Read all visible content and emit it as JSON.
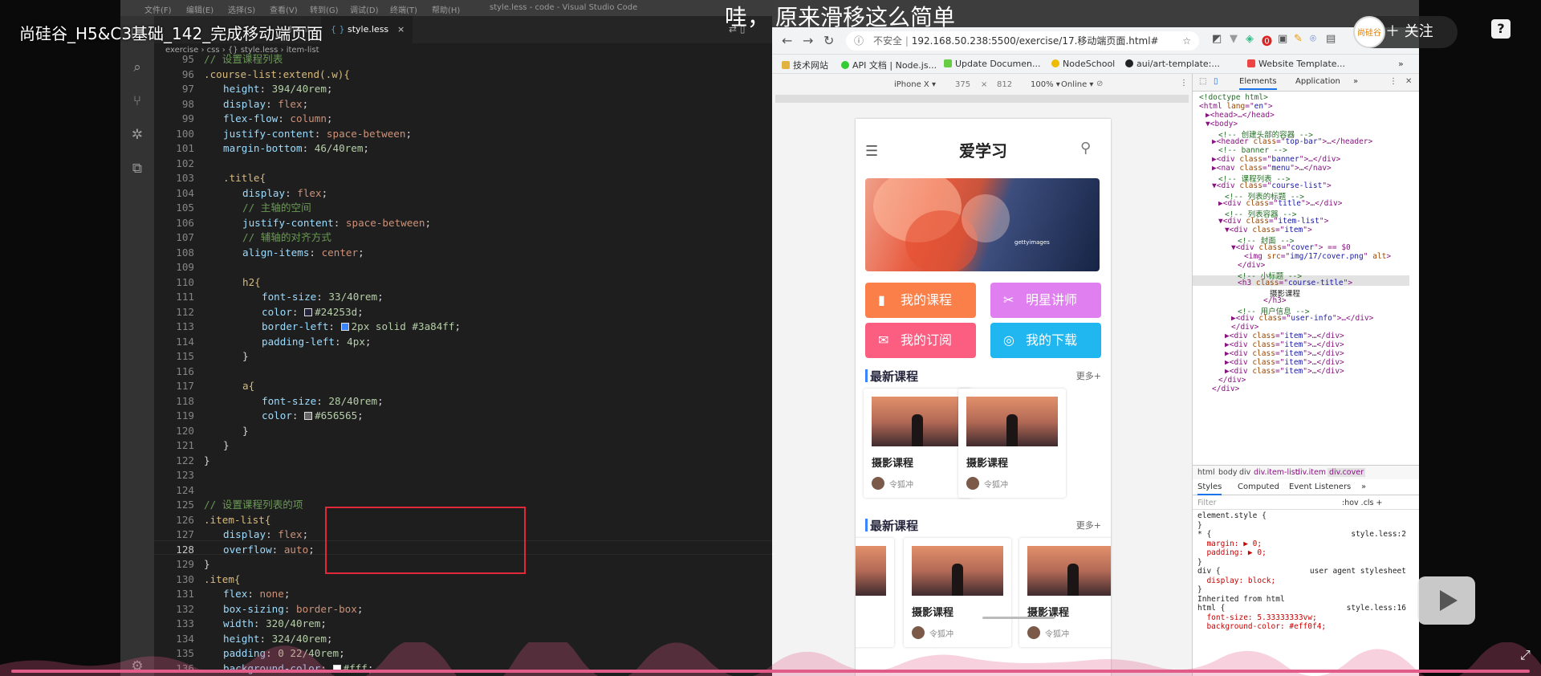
{
  "overlay": {
    "video_title": "尚硅谷_H5&C3基础_142_完成移动端页面",
    "hdr_wa": "哇，",
    "hdr_caption": "原来滑移这么简单",
    "follow": "关注",
    "logo_text": "尚硅谷",
    "help": "?"
  },
  "vscode": {
    "menu": [
      "文件(F)",
      "编辑(E)",
      "选择(S)",
      "查看(V)",
      "转到(G)",
      "调试(D)",
      "终端(T)",
      "帮助(H)"
    ],
    "window_title": "style.less - code - Visual Studio Code",
    "tabs": [
      {
        "label": "l.html"
      },
      {
        "label": "style.less"
      }
    ],
    "breadcrumb": [
      "exercise",
      "css",
      "{} style.less",
      "item-list"
    ],
    "code_lines": [
      {
        "n": "95",
        "t": "// 设置课程列表",
        "k": "cmt",
        "i": 0
      },
      {
        "n": "96",
        "t": ".course-list:extend(.w){",
        "k": "sel",
        "i": 0
      },
      {
        "n": "97",
        "p": "height",
        "v": "394/40rem",
        "i": 1
      },
      {
        "n": "98",
        "p": "display",
        "v": "flex",
        "i": 1
      },
      {
        "n": "99",
        "p": "flex-flow",
        "v": "column",
        "i": 1
      },
      {
        "n": "100",
        "p": "justify-content",
        "v": "space-between",
        "i": 1
      },
      {
        "n": "101",
        "p": "margin-bottom",
        "v": "46/40rem",
        "i": 1
      },
      {
        "n": "102",
        "t": "",
        "i": 0
      },
      {
        "n": "103",
        "t": ".title{",
        "k": "sel",
        "i": 1
      },
      {
        "n": "104",
        "p": "display",
        "v": "flex",
        "i": 2
      },
      {
        "n": "105",
        "t": "// 主轴的空间",
        "k": "cmt",
        "i": 2
      },
      {
        "n": "106",
        "p": "justify-content",
        "v": "space-between",
        "i": 2
      },
      {
        "n": "107",
        "t": "// 辅轴的对齐方式",
        "k": "cmt",
        "i": 2
      },
      {
        "n": "108",
        "p": "align-items",
        "v": "center",
        "i": 2
      },
      {
        "n": "109",
        "t": "",
        "i": 0
      },
      {
        "n": "110",
        "t": "h2{",
        "k": "sel",
        "i": 2
      },
      {
        "n": "111",
        "p": "font-size",
        "v": "33/40rem",
        "i": 3
      },
      {
        "n": "112",
        "p": "color",
        "v": "#24253d",
        "sw": "#24253d",
        "i": 3
      },
      {
        "n": "113",
        "p": "border-left",
        "v": "2px solid #3a84ff",
        "sw": "#3a84ff",
        "i": 3
      },
      {
        "n": "114",
        "p": "padding-left",
        "v": "4px",
        "i": 3
      },
      {
        "n": "115",
        "t": "}",
        "k": "pun",
        "i": 2
      },
      {
        "n": "116",
        "t": "",
        "i": 0
      },
      {
        "n": "117",
        "t": "a{",
        "k": "sel",
        "i": 2
      },
      {
        "n": "118",
        "p": "font-size",
        "v": "28/40rem",
        "i": 3
      },
      {
        "n": "119",
        "p": "color",
        "v": "#656565",
        "sw": "#656565",
        "i": 3
      },
      {
        "n": "120",
        "t": "}",
        "k": "pun",
        "i": 2
      },
      {
        "n": "121",
        "t": "}",
        "k": "pun",
        "i": 1
      },
      {
        "n": "122",
        "t": "}",
        "k": "pun",
        "i": 0
      },
      {
        "n": "123",
        "t": "",
        "i": 0
      },
      {
        "n": "124",
        "t": "",
        "i": 0
      },
      {
        "n": "125",
        "t": "// 设置课程列表的项",
        "k": "cmt",
        "i": 0
      },
      {
        "n": "126",
        "t": ".item-list{",
        "k": "sel",
        "i": 0
      },
      {
        "n": "127",
        "p": "display",
        "v": "flex",
        "i": 1
      },
      {
        "n": "128",
        "p": "overflow",
        "v": "auto",
        "i": 1
      },
      {
        "n": "129",
        "t": "}",
        "k": "pun",
        "i": 0
      },
      {
        "n": "130",
        "t": ".item{",
        "k": "sel",
        "i": 0
      },
      {
        "n": "131",
        "p": "flex",
        "v": "none",
        "i": 1
      },
      {
        "n": "132",
        "p": "box-sizing",
        "v": "border-box",
        "i": 1
      },
      {
        "n": "133",
        "p": "width",
        "v": "320/40rem",
        "i": 1
      },
      {
        "n": "134",
        "p": "height",
        "v": "324/40rem",
        "i": 1
      },
      {
        "n": "135",
        "p": "padding",
        "v": "0 22/40rem",
        "i": 1
      },
      {
        "n": "136",
        "p": "background-color",
        "v": "#fff",
        "sw": "#ffffff",
        "i": 1
      }
    ]
  },
  "browser": {
    "url_label": "不安全",
    "url": "192.168.50.238:5500/exercise/17.移动端页面.html#",
    "bookmarks": [
      "技术网站",
      "API 文档 | Node.js...",
      "Update Documen...",
      "NodeSchool",
      "aui/art-template:...",
      "Website Template..."
    ],
    "device": {
      "name": "iPhone X ▾",
      "width": "375",
      "x": "×",
      "height": "812",
      "zoom": "100% ▾",
      "net": "Online ▾"
    },
    "phone": {
      "title": "爱学习",
      "banner_mark": "gettyimages",
      "tiles": [
        {
          "label": "我的课程",
          "icon": "▮",
          "color": "#fa7f49"
        },
        {
          "label": "明星讲师",
          "icon": "✂",
          "color": "#e07ff0"
        },
        {
          "label": "我的订阅",
          "icon": "✉",
          "color": "#fb5e80"
        },
        {
          "label": "我的下载",
          "icon": "◎",
          "color": "#20b6f0"
        }
      ],
      "sections": [
        {
          "title": "最新课程",
          "more": "更多+",
          "cards": [
            {
              "title": "摄影课程",
              "author": "令狐冲"
            },
            {
              "title": "摄影课程",
              "author": "令狐冲"
            }
          ]
        },
        {
          "title": "最新课程",
          "more": "更多+",
          "cards": [
            {
              "title": "摄影课程",
              "author": "令狐冲"
            },
            {
              "title": "摄影课程",
              "author": "令狐冲"
            }
          ]
        }
      ]
    },
    "devtools": {
      "tabs": [
        "Elements",
        "Application",
        "»"
      ],
      "dom": [
        {
          "ind": 0,
          "html": "&lt;!doctype html&gt;",
          "cls": "cm"
        },
        {
          "ind": 0,
          "html": "&lt;html <span class='att'>lang</span>=\"<span class='av'>en</span>\"&gt;"
        },
        {
          "ind": 1,
          "html": "▶&lt;head&gt;…&lt;/head&gt;"
        },
        {
          "ind": 1,
          "html": "▼&lt;body&gt;"
        },
        {
          "ind": 3,
          "html": "&lt;!-- 创建头部的容器 --&gt;",
          "cls": "cm"
        },
        {
          "ind": 2,
          "html": "▶&lt;header <span class='att'>class</span>=\"<span class='av'>top-bar</span>\"&gt;…&lt;/header&gt;"
        },
        {
          "ind": 3,
          "html": "&lt;!-- banner --&gt;",
          "cls": "cm"
        },
        {
          "ind": 2,
          "html": "▶&lt;div <span class='att'>class</span>=\"<span class='av'>banner</span>\"&gt;…&lt;/div&gt;"
        },
        {
          "ind": 2,
          "html": "▶&lt;nav <span class='att'>class</span>=\"<span class='av'>menu</span>\"&gt;…&lt;/nav&gt;"
        },
        {
          "ind": 3,
          "html": "&lt;!-- 课程列表 --&gt;",
          "cls": "cm"
        },
        {
          "ind": 2,
          "html": "▼&lt;div <span class='att'>class</span>=\"<span class='av'>course-list</span>\"&gt;"
        },
        {
          "ind": 4,
          "html": "&lt;!-- 列表的标题 --&gt;",
          "cls": "cm"
        },
        {
          "ind": 3,
          "html": "▶&lt;div <span class='att'>class</span>=\"<span class='av'>title</span>\"&gt;…&lt;/div&gt;"
        },
        {
          "ind": 4,
          "html": "&lt;!-- 列表容器 --&gt;",
          "cls": "cm"
        },
        {
          "ind": 3,
          "html": "▼&lt;div <span class='att'>class</span>=\"<span class='av'>item-list</span>\"&gt;"
        },
        {
          "ind": 4,
          "html": "▼&lt;div <span class='att'>class</span>=\"<span class='av'>item</span>\"&gt;"
        },
        {
          "ind": 6,
          "html": "&lt;!-- 封面 --&gt;",
          "cls": "cm"
        },
        {
          "ind": 5,
          "html": "▼&lt;div <span class='att'>class</span>=\"<span class='av'>cover</span>\"&gt; == $0"
        },
        {
          "ind": 7,
          "html": "&lt;img <span class='att'>src</span>=\"<span class='av'>img/17/cover.png</span>\" <span class='att'>alt</span>&gt;"
        },
        {
          "ind": 6,
          "html": "&lt;/div&gt;"
        },
        {
          "ind": 6,
          "html": "&lt;!-- 小标题 --&gt;",
          "cls": "cm"
        },
        {
          "ind": 6,
          "html": "&lt;h3 <span class='att'>class</span>=\"<span class='av'>course-title</span>\"&gt;"
        },
        {
          "ind": 11,
          "html": "<span class='tx'>摄影课程</span>"
        },
        {
          "ind": 10,
          "html": "&lt;/h3&gt;"
        },
        {
          "ind": 6,
          "html": "&lt;!-- 用户信息 --&gt;",
          "cls": "cm"
        },
        {
          "ind": 5,
          "html": "▶&lt;div <span class='att'>class</span>=\"<span class='av'>user-info</span>\"&gt;…&lt;/div&gt;"
        },
        {
          "ind": 5,
          "html": "&lt;/div&gt;"
        },
        {
          "ind": 4,
          "html": "▶&lt;div <span class='att'>class</span>=\"<span class='av'>item</span>\"&gt;…&lt;/div&gt;"
        },
        {
          "ind": 4,
          "html": "▶&lt;div <span class='att'>class</span>=\"<span class='av'>item</span>\"&gt;…&lt;/div&gt;"
        },
        {
          "ind": 4,
          "html": "▶&lt;div <span class='att'>class</span>=\"<span class='av'>item</span>\"&gt;…&lt;/div&gt;"
        },
        {
          "ind": 4,
          "html": "▶&lt;div <span class='att'>class</span>=\"<span class='av'>item</span>\"&gt;…&lt;/div&gt;"
        },
        {
          "ind": 4,
          "html": "▶&lt;div <span class='att'>class</span>=\"<span class='av'>item</span>\"&gt;…&lt;/div&gt;"
        },
        {
          "ind": 3,
          "html": "&lt;/div&gt;"
        },
        {
          "ind": 2,
          "html": "&lt;/div&gt;"
        }
      ],
      "crumbs": [
        "html",
        "body",
        "div",
        "div.item-list",
        "div.item",
        "div.cover"
      ],
      "style_tabs": [
        "Styles",
        "Computed",
        "Event Listeners",
        "»"
      ],
      "filter": "Filter",
      "filter_tools": ":hov  .cls  +",
      "styles": [
        {
          "t": "element.style {"
        },
        {
          "t": "}"
        },
        {
          "t": "* {",
          "src": "style.less:2"
        },
        {
          "t": "  margin: ▶ 0;",
          "p": 1
        },
        {
          "t": "  padding: ▶ 0;",
          "p": 1
        },
        {
          "t": "}"
        },
        {
          "t": "div {",
          "src": "user agent stylesheet"
        },
        {
          "t": "  display: block;",
          "p": 1
        },
        {
          "t": "}"
        },
        {
          "t": "Inherited from html"
        },
        {
          "t": "html {",
          "src": "style.less:16"
        },
        {
          "t": "  font-size: 5.33333333vw;",
          "p": 1
        },
        {
          "t": "  background-color: #eff0f4;",
          "p": 1
        }
      ]
    }
  }
}
